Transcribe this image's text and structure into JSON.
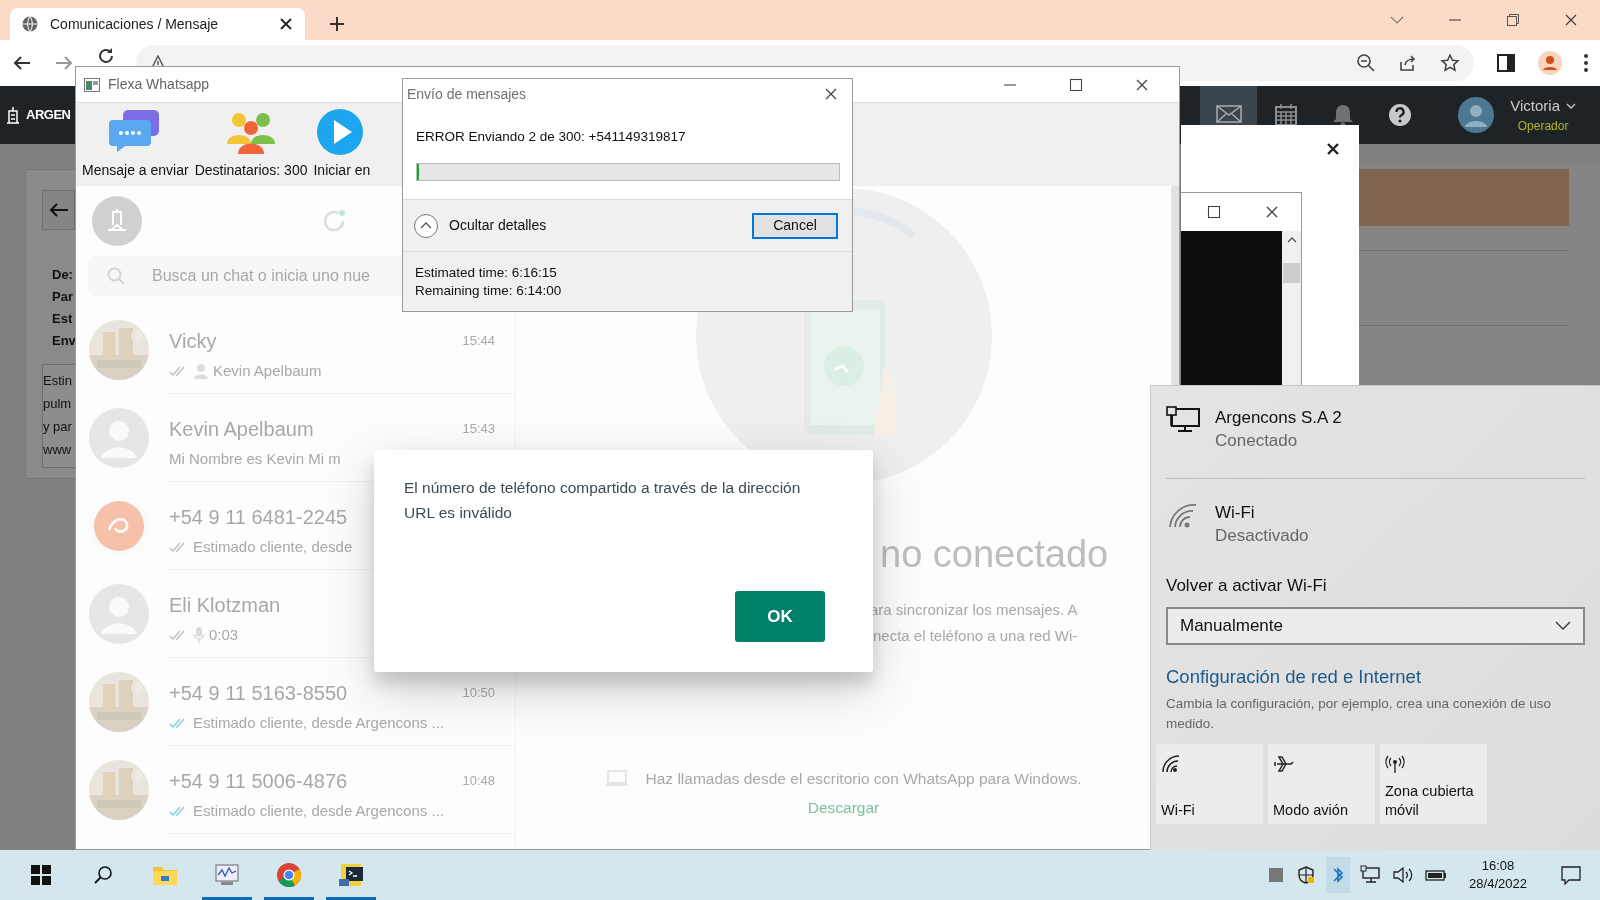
{
  "browser": {
    "tab": {
      "title": "Comunicaciones / Mensaje"
    }
  },
  "site_header": {
    "logo": "ARGEN",
    "nav": [
      {
        "kind": "mail",
        "selected": true
      },
      {
        "kind": "calendar",
        "selected": false
      },
      {
        "kind": "bell",
        "selected": false
      },
      {
        "kind": "help",
        "selected": false
      }
    ],
    "user": {
      "name": "Victoria",
      "role": "Operador"
    }
  },
  "message_card": {
    "labels": [
      "De:",
      "Par",
      "Est",
      "Env"
    ],
    "body_lines": [
      "Estin",
      "pulm",
      "y par",
      "www"
    ]
  },
  "flexa": {
    "title": "Flexa Whatsapp",
    "toolbar": [
      {
        "kind": "message",
        "label": "Mensaje a enviar"
      },
      {
        "kind": "recipients",
        "label": "Destinatarios: 300"
      },
      {
        "kind": "start",
        "label": "Iniciar en"
      }
    ],
    "search": {
      "placeholder": "Busca un chat o inicia uno nue"
    },
    "chats": [
      {
        "name": "Vicky",
        "time": "15:44",
        "preview": "Kevin Apelbaum",
        "delivered": true,
        "read": false,
        "kind": "contact"
      },
      {
        "name": "Kevin Apelbaum",
        "time": "15:43",
        "preview": "Mi Nombre es Kevin  Mi m",
        "avatar": {
          "kind": "default"
        },
        "delivered": false,
        "kind": "text"
      },
      {
        "name": "+54 9 11 6481-2245",
        "preview": "Estimado cliente, desde",
        "avatar": {
          "kind": "logo"
        },
        "delivered": true,
        "read": false,
        "kind": "text"
      },
      {
        "name": "Eli Klotzman",
        "preview": "0:03",
        "avatar": {
          "kind": "default"
        },
        "delivered": true,
        "read": false,
        "kind": "voice"
      },
      {
        "name": "+54 9 11 5163-8550",
        "time": "10:50",
        "preview": "Estimado cliente, desde Argencons ...",
        "delivered": true,
        "read": true,
        "kind": "text"
      },
      {
        "name": "+54 9 11 5006-4876",
        "time": "10:48",
        "preview": "Estimado cliente, desde Argencons ...",
        "delivered": true,
        "read": true,
        "kind": "text"
      }
    ],
    "main": {
      "heading": "no conectado",
      "lines": [
        "ara sincronizar los mensajes. A",
        "necta el teléfono a una red Wi-"
      ],
      "call_hint": "Haz llamadas desde el escritorio con WhatsApp para Windows.",
      "download_link": "Descargar"
    }
  },
  "send_dialog": {
    "title": "Envío de mensajes",
    "status": "ERROR Enviando 2 de 300: +541149319817",
    "progress": {
      "level": 0.005
    },
    "expanded": true,
    "details_toggle": "Ocultar detalles",
    "cancel": "Cancel",
    "estimated": "Estimated time: 6:16:15",
    "remaining": "Remaining time: 6:14:00"
  },
  "alert": {
    "message": "El número de teléfono compartido a través de la dirección URL es inválido",
    "ok": "OK"
  },
  "network_flyout": {
    "connection": {
      "name": "Argencons S.A 2",
      "status": "Conectado"
    },
    "wifi": {
      "name": "Wi-Fi",
      "status": "Desactivado",
      "on": false
    },
    "reenable_label": "Volver a activar Wi-Fi",
    "reenable": {
      "value": "Manualmente"
    },
    "settings_link": "Configuración de red e Internet",
    "settings_hint": "Cambia la configuración, por ejemplo, crea una conexión de uso medido.",
    "quick_actions": [
      {
        "kind": "wifi",
        "label": "Wi-Fi",
        "on": false
      },
      {
        "kind": "airplane",
        "label": "Modo avión",
        "on": false
      },
      {
        "kind": "hotspot",
        "label": "Zona cubierta móvil",
        "on": false
      }
    ]
  },
  "taskbar": {
    "apps": [
      {
        "kind": "explorer",
        "running": false
      },
      {
        "kind": "monitor",
        "running": true
      },
      {
        "kind": "browser",
        "running": true
      },
      {
        "kind": "terminal",
        "running": true
      }
    ],
    "clock": {
      "time": "16:08",
      "date": "28/4/2022"
    }
  }
}
